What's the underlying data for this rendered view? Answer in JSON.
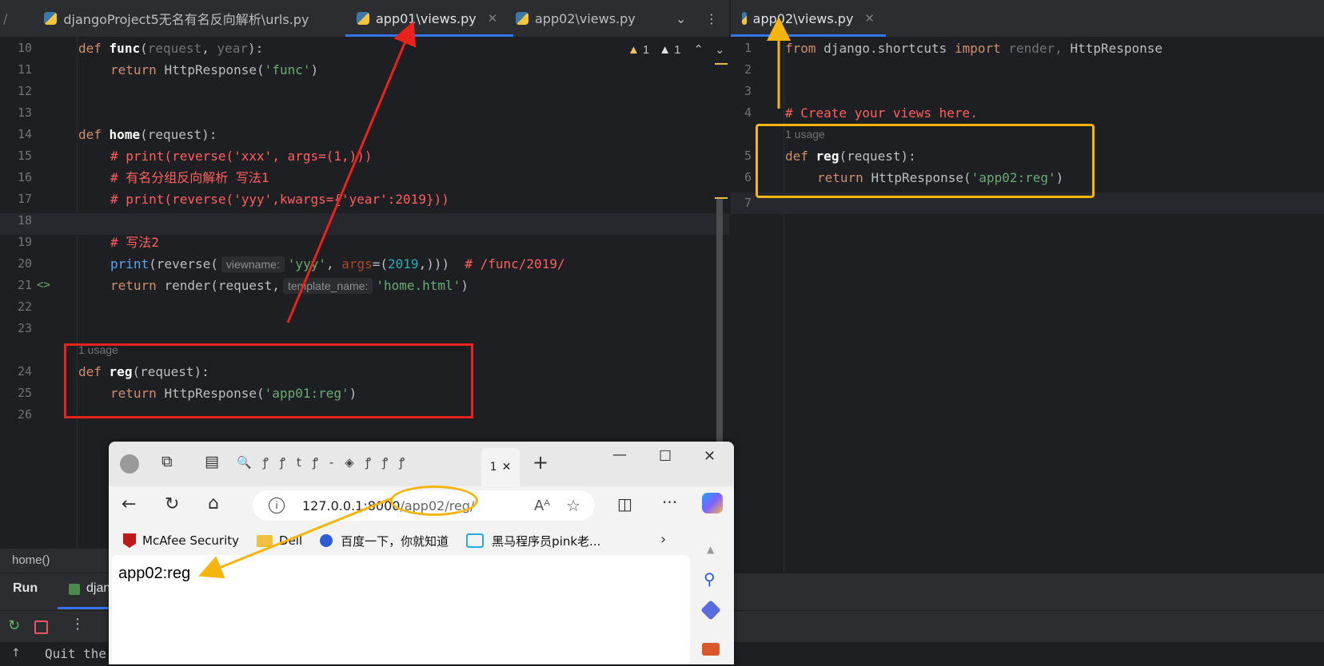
{
  "left_tabs": [
    {
      "label": "djangoProject5无名有名反向解析\\urls.py",
      "active": false
    },
    {
      "label": "app01\\views.py",
      "active": true
    },
    {
      "label": "app02\\views.py",
      "active": false
    }
  ],
  "right_tabs": [
    {
      "label": "app02\\views.py",
      "active": true
    }
  ],
  "inspection": {
    "warn1": "1",
    "warn2": "1"
  },
  "left_editor": {
    "lines": [
      {
        "n": "10"
      },
      {
        "n": "11"
      },
      {
        "n": "12"
      },
      {
        "n": "13"
      },
      {
        "n": "14"
      },
      {
        "n": "15"
      },
      {
        "n": "16"
      },
      {
        "n": "17"
      },
      {
        "n": "18"
      },
      {
        "n": "19"
      },
      {
        "n": "20"
      },
      {
        "n": "21"
      },
      {
        "n": "22"
      },
      {
        "n": "23"
      },
      {
        "n": "24"
      },
      {
        "n": "25"
      },
      {
        "n": "26"
      }
    ],
    "code": {
      "l10_def": "def",
      "l10_name": "func",
      "l10_open": "(",
      "l10_p1": "request",
      "l10_comma": ", ",
      "l10_p2": "year",
      "l10_close": "):",
      "l11_ret": "return",
      "l11_call": "HttpResponse(",
      "l11_str": "'func'",
      "l11_end": ")",
      "l14_def": "def",
      "l14_name": "home",
      "l14_args": "(request):",
      "l15": "# print(reverse('xxx', args=(1,)))",
      "l16": "# 有名分组反向解析 写法1",
      "l17": "# print(reverse('yyy',kwargs={'year':2019}))",
      "l19": "# 写法2",
      "l20_print": "print",
      "l20_rev": "(reverse(",
      "l20_hint": "viewname:",
      "l20_str": "'yyy'",
      "l20_comma": ", ",
      "l20_kw": "args",
      "l20_eq": "=(",
      "l20_num": "2019",
      "l20_end": ",)))",
      "l20_cm": "# /func/2019/",
      "l21_ret": "return",
      "l21_call": "render(request,",
      "l21_hint": "template_name:",
      "l21_str": "'home.html'",
      "l21_end": ")",
      "usage": "1 usage",
      "l24_def": "def",
      "l24_name": "reg",
      "l24_args": "(request):",
      "l25_ret": "return",
      "l25_call": "HttpResponse(",
      "l25_str": "'app01:reg'",
      "l25_end": ")"
    },
    "gutter_marker": "<>"
  },
  "right_editor": {
    "lines": [
      {
        "n": "1"
      },
      {
        "n": "2"
      },
      {
        "n": "3"
      },
      {
        "n": "4"
      },
      {
        "n": "5"
      },
      {
        "n": "6"
      },
      {
        "n": "7"
      }
    ],
    "code": {
      "l1_from": "from",
      "l1_mod": "django.shortcuts",
      "l1_import": "import",
      "l1_render": "render,",
      "l1_http": "HttpResponse",
      "l4": "# Create your views here.",
      "usage": "1 usage",
      "l5_def": "def",
      "l5_name": "reg",
      "l5_args": "(request):",
      "l6_ret": "return",
      "l6_call": "HttpResponse(",
      "l6_str": "'app02:reg'",
      "l6_end": ")"
    }
  },
  "breadcrumb": "home()",
  "run_panel": {
    "title": "Run",
    "tab": "djan",
    "console": "Quit the"
  },
  "browser": {
    "tab_count": "1",
    "url_host": "127.0.0.1:8000",
    "url_path": "/app02/reg/",
    "favorites": [
      {
        "label": "McAfee Security",
        "icon": "mcafee-icon"
      },
      {
        "label": "Dell",
        "icon": "folder-icon"
      },
      {
        "label": "百度一下，你就知道",
        "icon": "baidu-icon"
      },
      {
        "label": "黑马程序员pink老...",
        "icon": "bilibili-icon"
      }
    ],
    "page_text": "app02:reg"
  },
  "colors": {
    "red_box": "#e8231c",
    "yellow_box": "#f5b50c",
    "accent": "#3574f0"
  }
}
